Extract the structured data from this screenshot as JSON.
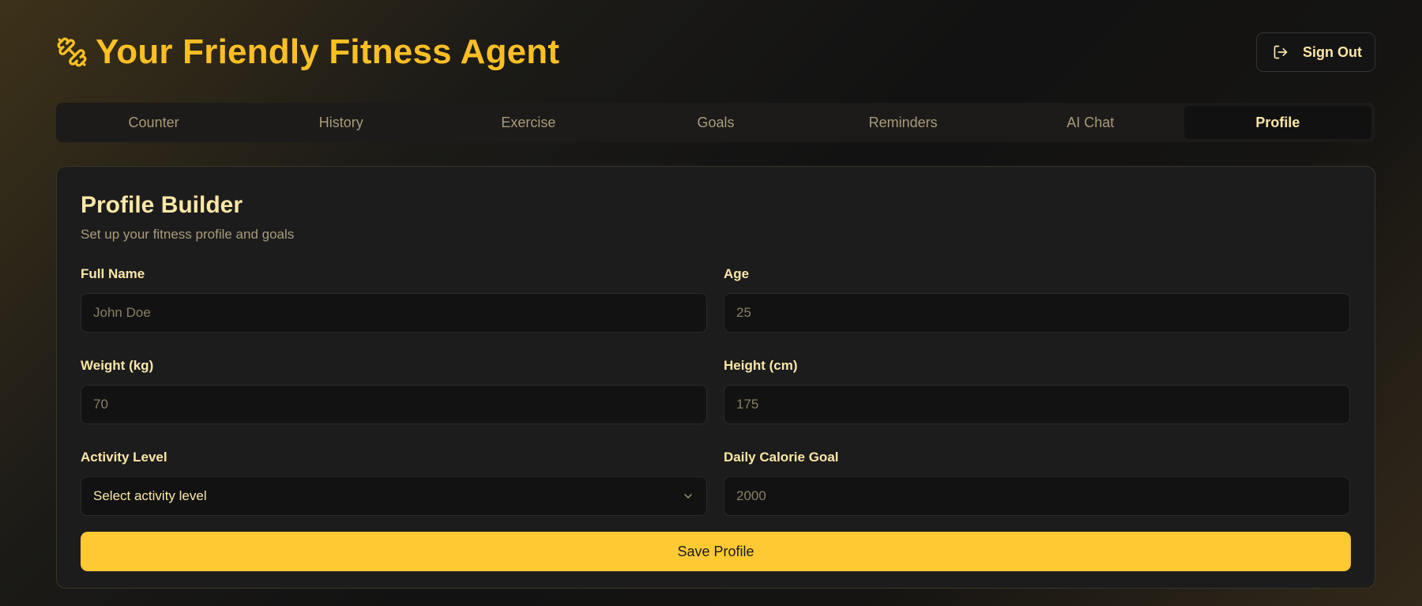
{
  "app": {
    "title": "Your Friendly Fitness Agent",
    "logo_icon": "dumbbell-icon",
    "sign_out_label": "Sign Out",
    "sign_out_icon": "log-out-icon"
  },
  "tabs": [
    {
      "label": "Counter",
      "active": false
    },
    {
      "label": "History",
      "active": false
    },
    {
      "label": "Exercise",
      "active": false
    },
    {
      "label": "Goals",
      "active": false
    },
    {
      "label": "Reminders",
      "active": false
    },
    {
      "label": "AI Chat",
      "active": false
    },
    {
      "label": "Profile",
      "active": true
    }
  ],
  "profile": {
    "title": "Profile Builder",
    "subtitle": "Set up your fitness profile and goals",
    "fields": {
      "full_name": {
        "label": "Full Name",
        "value": "",
        "placeholder": "John Doe"
      },
      "age": {
        "label": "Age",
        "value": "",
        "placeholder": "25"
      },
      "weight": {
        "label": "Weight (kg)",
        "value": "",
        "placeholder": "70"
      },
      "height": {
        "label": "Height (cm)",
        "value": "",
        "placeholder": "175"
      },
      "activity_level": {
        "label": "Activity Level",
        "value": "Select activity level"
      },
      "daily_calorie_goal": {
        "label": "Daily Calorie Goal",
        "value": "",
        "placeholder": "2000"
      }
    },
    "save_label": "Save Profile"
  },
  "colors": {
    "accent": "#fbbf24",
    "button": "#ffc933",
    "text_light": "#fce7a6",
    "muted": "#a99b7c"
  }
}
